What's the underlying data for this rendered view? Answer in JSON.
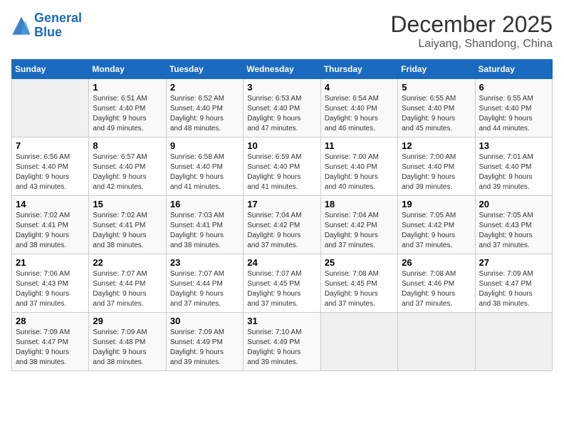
{
  "header": {
    "logo_line1": "General",
    "logo_line2": "Blue",
    "month": "December 2025",
    "location": "Laiyang, Shandong, China"
  },
  "days_of_week": [
    "Sunday",
    "Monday",
    "Tuesday",
    "Wednesday",
    "Thursday",
    "Friday",
    "Saturday"
  ],
  "weeks": [
    [
      {
        "day": "",
        "info": ""
      },
      {
        "day": "1",
        "info": "Sunrise: 6:51 AM\nSunset: 4:40 PM\nDaylight: 9 hours\nand 49 minutes."
      },
      {
        "day": "2",
        "info": "Sunrise: 6:52 AM\nSunset: 4:40 PM\nDaylight: 9 hours\nand 48 minutes."
      },
      {
        "day": "3",
        "info": "Sunrise: 6:53 AM\nSunset: 4:40 PM\nDaylight: 9 hours\nand 47 minutes."
      },
      {
        "day": "4",
        "info": "Sunrise: 6:54 AM\nSunset: 4:40 PM\nDaylight: 9 hours\nand 46 minutes."
      },
      {
        "day": "5",
        "info": "Sunrise: 6:55 AM\nSunset: 4:40 PM\nDaylight: 9 hours\nand 45 minutes."
      },
      {
        "day": "6",
        "info": "Sunrise: 6:55 AM\nSunset: 4:40 PM\nDaylight: 9 hours\nand 44 minutes."
      }
    ],
    [
      {
        "day": "7",
        "info": "Sunrise: 6:56 AM\nSunset: 4:40 PM\nDaylight: 9 hours\nand 43 minutes."
      },
      {
        "day": "8",
        "info": "Sunrise: 6:57 AM\nSunset: 4:40 PM\nDaylight: 9 hours\nand 42 minutes."
      },
      {
        "day": "9",
        "info": "Sunrise: 6:58 AM\nSunset: 4:40 PM\nDaylight: 9 hours\nand 41 minutes."
      },
      {
        "day": "10",
        "info": "Sunrise: 6:59 AM\nSunset: 4:40 PM\nDaylight: 9 hours\nand 41 minutes."
      },
      {
        "day": "11",
        "info": "Sunrise: 7:00 AM\nSunset: 4:40 PM\nDaylight: 9 hours\nand 40 minutes."
      },
      {
        "day": "12",
        "info": "Sunrise: 7:00 AM\nSunset: 4:40 PM\nDaylight: 9 hours\nand 39 minutes."
      },
      {
        "day": "13",
        "info": "Sunrise: 7:01 AM\nSunset: 4:40 PM\nDaylight: 9 hours\nand 39 minutes."
      }
    ],
    [
      {
        "day": "14",
        "info": "Sunrise: 7:02 AM\nSunset: 4:41 PM\nDaylight: 9 hours\nand 38 minutes."
      },
      {
        "day": "15",
        "info": "Sunrise: 7:02 AM\nSunset: 4:41 PM\nDaylight: 9 hours\nand 38 minutes."
      },
      {
        "day": "16",
        "info": "Sunrise: 7:03 AM\nSunset: 4:41 PM\nDaylight: 9 hours\nand 38 minutes."
      },
      {
        "day": "17",
        "info": "Sunrise: 7:04 AM\nSunset: 4:42 PM\nDaylight: 9 hours\nand 37 minutes."
      },
      {
        "day": "18",
        "info": "Sunrise: 7:04 AM\nSunset: 4:42 PM\nDaylight: 9 hours\nand 37 minutes."
      },
      {
        "day": "19",
        "info": "Sunrise: 7:05 AM\nSunset: 4:42 PM\nDaylight: 9 hours\nand 37 minutes."
      },
      {
        "day": "20",
        "info": "Sunrise: 7:05 AM\nSunset: 4:43 PM\nDaylight: 9 hours\nand 37 minutes."
      }
    ],
    [
      {
        "day": "21",
        "info": "Sunrise: 7:06 AM\nSunset: 4:43 PM\nDaylight: 9 hours\nand 37 minutes."
      },
      {
        "day": "22",
        "info": "Sunrise: 7:07 AM\nSunset: 4:44 PM\nDaylight: 9 hours\nand 37 minutes."
      },
      {
        "day": "23",
        "info": "Sunrise: 7:07 AM\nSunset: 4:44 PM\nDaylight: 9 hours\nand 37 minutes."
      },
      {
        "day": "24",
        "info": "Sunrise: 7:07 AM\nSunset: 4:45 PM\nDaylight: 9 hours\nand 37 minutes."
      },
      {
        "day": "25",
        "info": "Sunrise: 7:08 AM\nSunset: 4:45 PM\nDaylight: 9 hours\nand 37 minutes."
      },
      {
        "day": "26",
        "info": "Sunrise: 7:08 AM\nSunset: 4:46 PM\nDaylight: 9 hours\nand 37 minutes."
      },
      {
        "day": "27",
        "info": "Sunrise: 7:09 AM\nSunset: 4:47 PM\nDaylight: 9 hours\nand 38 minutes."
      }
    ],
    [
      {
        "day": "28",
        "info": "Sunrise: 7:09 AM\nSunset: 4:47 PM\nDaylight: 9 hours\nand 38 minutes."
      },
      {
        "day": "29",
        "info": "Sunrise: 7:09 AM\nSunset: 4:48 PM\nDaylight: 9 hours\nand 38 minutes."
      },
      {
        "day": "30",
        "info": "Sunrise: 7:09 AM\nSunset: 4:49 PM\nDaylight: 9 hours\nand 39 minutes."
      },
      {
        "day": "31",
        "info": "Sunrise: 7:10 AM\nSunset: 4:49 PM\nDaylight: 9 hours\nand 39 minutes."
      },
      {
        "day": "",
        "info": ""
      },
      {
        "day": "",
        "info": ""
      },
      {
        "day": "",
        "info": ""
      }
    ]
  ]
}
